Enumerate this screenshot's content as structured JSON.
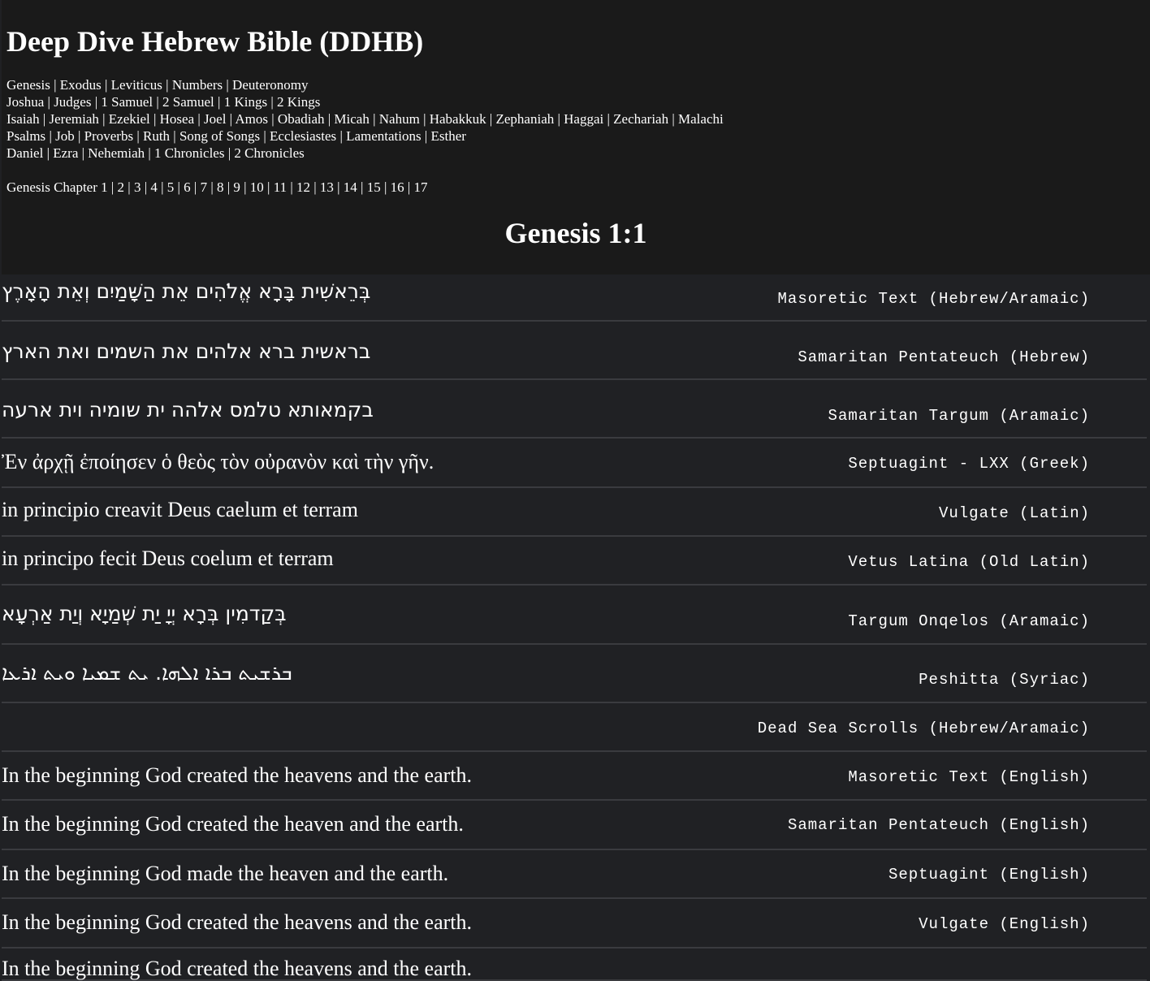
{
  "site_title": "Deep Dive Hebrew Bible (DDHB)",
  "book_groups": [
    [
      "Genesis",
      "Exodus",
      "Leviticus",
      "Numbers",
      "Deuteronomy"
    ],
    [
      "Joshua",
      "Judges",
      "1 Samuel",
      "2 Samuel",
      "1 Kings",
      "2 Kings"
    ],
    [
      "Isaiah",
      "Jeremiah",
      "Ezekiel",
      "Hosea",
      "Joel",
      "Amos",
      "Obadiah",
      "Micah",
      "Nahum",
      "Habakkuk",
      "Zephaniah",
      "Haggai",
      "Zechariah",
      "Malachi"
    ],
    [
      "Psalms",
      "Job",
      "Proverbs",
      "Ruth",
      "Song of Songs",
      "Ecclesiastes",
      "Lamentations",
      "Esther"
    ],
    [
      "Daniel",
      "Ezra",
      "Nehemiah",
      "1 Chronicles",
      "2 Chronicles"
    ]
  ],
  "chapter_nav": {
    "prefix": "Genesis Chapter",
    "chapters": [
      "1",
      "2",
      "3",
      "4",
      "5",
      "6",
      "7",
      "8",
      "9",
      "10",
      "11",
      "12",
      "13",
      "14",
      "15",
      "16",
      "17"
    ]
  },
  "verse_heading": "Genesis 1:1",
  "versions": [
    {
      "text": "בְּרֵאשִׁית בָּרָא אֱלֹהִים אֵת הַשָּׁמַיִם וְאֵת הָאָרֶץ",
      "label": "Masoretic Text (Hebrew/Aramaic)",
      "script": "semitic"
    },
    {
      "text": "בראשית ברא אלהים את השמים ואת הארץ",
      "label": "Samaritan Pentateuch (Hebrew)",
      "script": "semitic"
    },
    {
      "text": "בקמאותא טלמס אלהה ית שומיה וית ארעה",
      "label": "Samaritan Targum (Aramaic)",
      "script": "semitic"
    },
    {
      "text": "Ἐν ἀρχῇ ἐποίησεν ὁ θεὸς τὸν οὐρανὸν καὶ τὴν γῆν.",
      "label": "Septuagint - LXX (Greek)",
      "script": "latin"
    },
    {
      "text": "in principio creavit Deus caelum et terram",
      "label": "Vulgate (Latin)",
      "script": "latin"
    },
    {
      "text": "in principo fecit Deus coelum et terram",
      "label": "Vetus Latina (Old Latin)",
      "script": "latin"
    },
    {
      "text": "בְּקַדמִין בְּרָא יְיָ יַת שְׁמַיָא וְיַת אַרְעָא",
      "label": "Targum Onqelos (Aramaic)",
      "script": "semitic"
    },
    {
      "text": "ܒܪܫܝܬ ܒܪܐ ܐܠܗܐ. ܝܬ ܫܡܝܐ ܘܝܬ ܐܪܥܐ",
      "label": "Peshitta (Syriac)",
      "script": "semitic"
    },
    {
      "text": "",
      "label": "Dead Sea Scrolls (Hebrew/Aramaic)",
      "script": "latin"
    },
    {
      "text": "In the beginning God created the heavens and the earth.",
      "label": "Masoretic Text (English)",
      "script": "latin"
    },
    {
      "text": "In the beginning God created the heaven and the earth.",
      "label": "Samaritan Pentateuch (English)",
      "script": "latin"
    },
    {
      "text": "In the beginning God made the heaven and the earth.",
      "label": "Septuagint (English)",
      "script": "latin"
    },
    {
      "text": "In the beginning God created the heavens and the earth.",
      "label": "Vulgate (English)",
      "script": "latin"
    },
    {
      "text": "In the beginning God created the heavens and the earth.",
      "label": "",
      "script": "latin"
    }
  ]
}
